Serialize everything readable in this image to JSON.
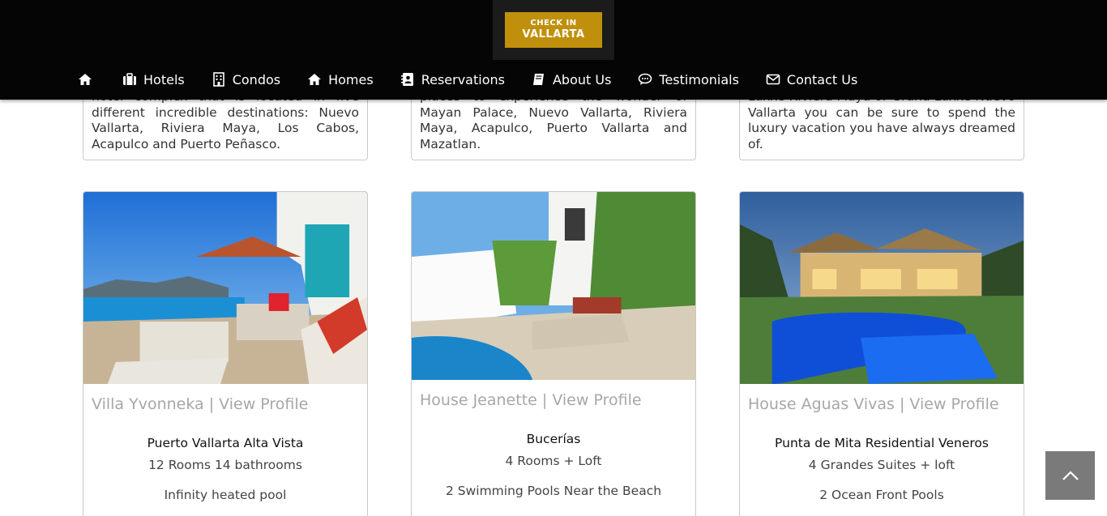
{
  "header": {
    "logo": {
      "line1": "CHECK IN",
      "line2": "VALLARTA"
    },
    "nav": [
      {
        "label": "",
        "icon": "home-icon"
      },
      {
        "label": "Hotels",
        "icon": "briefcase-icon"
      },
      {
        "label": "Condos",
        "icon": "building-icon"
      },
      {
        "label": "Homes",
        "icon": "house-icon"
      },
      {
        "label": "Reservations",
        "icon": "address-book-icon"
      },
      {
        "label": "About Us",
        "icon": "book-icon"
      },
      {
        "label": "Testimonials",
        "icon": "chat-bubble-icon"
      },
      {
        "label": "Contact Us",
        "icon": "envelope-icon"
      }
    ]
  },
  "top_cards": [
    {
      "text": "hotel complex that is located in five different incredible destinations: Nuevo Vallarta, Riviera Maya, Los Cabos, Acapulco and Puerto Peñasco."
    },
    {
      "text": "places to experience the wonder of Mayan Palace, Nuevo Vallarta, Riviera Maya, Acapulco, Puerto Vallarta and Mazatlan."
    },
    {
      "text": "Luxxe Riviera Maya or Grand Luxxe Nuevo Vallarta you can be sure to spend the luxury vacation you have always dreamed of."
    }
  ],
  "properties": [
    {
      "name": "Villa Yvonneka",
      "separator": " | ",
      "link": "View Profile",
      "location": "Puerto Vallarta Alta Vista",
      "rooms": "12 Rooms 14 bathrooms",
      "feature": "Infinity heated pool"
    },
    {
      "name": "House Jeanette",
      "separator": " | ",
      "link": "View Profile",
      "location": "Bucerías",
      "rooms": "4 Rooms + Loft",
      "feature": "2 Swimming Pools Near the Beach"
    },
    {
      "name": "House Aguas Vivas",
      "separator": " | ",
      "link": "View Profile",
      "location": "Punta de Mita Residential Veneros",
      "rooms": "4 Grandes Suites + loft",
      "feature": "2 Ocean Front Pools"
    }
  ],
  "colors": {
    "header_bg": "#050505",
    "logo_gold": "#c0900c",
    "title_gray": "#a7a7a7",
    "to_top_bg": "#7a7a7a"
  }
}
